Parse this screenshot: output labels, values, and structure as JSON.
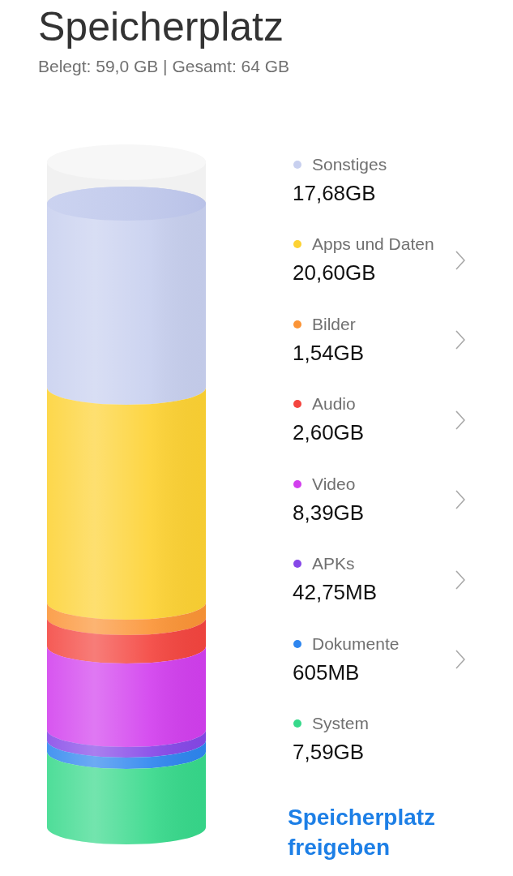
{
  "title": "Speicherplatz",
  "summary": "Belegt: 59,0 GB | Gesamt: 64 GB",
  "categories": [
    {
      "label": "Sonstiges",
      "size": "17,68GB",
      "color": "#c8d0ef",
      "kind": "info"
    },
    {
      "label": "Apps und Daten",
      "size": "20,60GB",
      "color": "#fdd233",
      "kind": "link"
    },
    {
      "label": "Bilder",
      "size": "1,54GB",
      "color": "#fb9436",
      "kind": "link"
    },
    {
      "label": "Audio",
      "size": "2,60GB",
      "color": "#f4453f",
      "kind": "link"
    },
    {
      "label": "Video",
      "size": "8,39GB",
      "color": "#d23fee",
      "kind": "link"
    },
    {
      "label": "APKs",
      "size": "42,75MB",
      "color": "#8648e8",
      "kind": "link"
    },
    {
      "label": "Dokumente",
      "size": "605MB",
      "color": "#2e86ef",
      "kind": "link"
    },
    {
      "label": "System",
      "size": "7,59GB",
      "color": "#37d98b",
      "kind": "info"
    }
  ],
  "free_up_button": {
    "label": "Speicherplatz freigeben"
  }
}
